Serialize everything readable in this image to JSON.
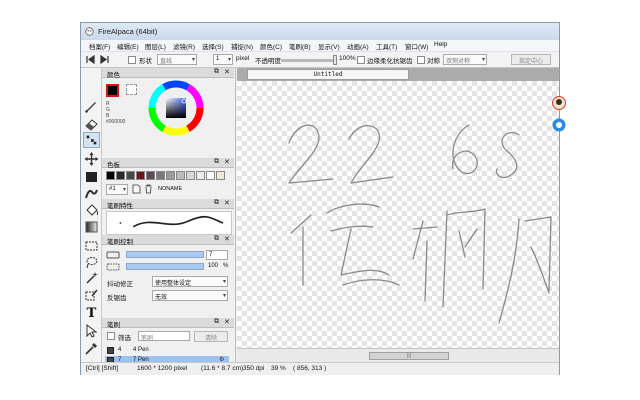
{
  "window": {
    "title": "FireAlpaca (64bit)"
  },
  "menu": [
    "档案(F)",
    "编辑(E)",
    "图层(L)",
    "滤镜(R)",
    "选择(S)",
    "捕捉(N)",
    "颜色(C)",
    "笔刷(B)",
    "显示(V)",
    "动画(A)",
    "工具(T)",
    "窗口(W)",
    "Help"
  ],
  "toolbar": {
    "shape_label": "形状",
    "shape_value": "直线",
    "size_value": "1",
    "size_unit": "pixel",
    "opacity_label": "不透明度",
    "opacity_value": "100%",
    "opacity_fraction": 1.0,
    "antialias_label": "边缘柔化抗锯齿",
    "symmetry_label": "对称",
    "symmetry_value": "双侧对称",
    "center_button": "指定中心"
  },
  "panels": {
    "color": {
      "title": "颜色",
      "channel_labels": [
        "R",
        "G",
        "B"
      ],
      "hex": "#000000",
      "fg_color": "#000000",
      "bg_color": "#ffffff"
    },
    "palette": {
      "title": "色板",
      "selector": "#1",
      "name": "NONAME",
      "swatches": [
        "#000000",
        "#2a2a2a",
        "#4a4a4a",
        "#6a1616",
        "#5a4a5a",
        "#7a7a7a",
        "#9b9b9b",
        "#bcbcbc",
        "#d8d8d8",
        "#ececec",
        "#ffffff",
        "#f0e8dc"
      ]
    },
    "brush_stroke": {
      "title": "笔刷特性"
    },
    "brush_control": {
      "title": "笔刷控制",
      "size_value": "7",
      "size_fraction": 1.0,
      "opacity_value": "100",
      "opacity_unit": "%",
      "opacity_fraction": 1.0,
      "stabilizer_label": "抖动修正",
      "stabilizer_value": "使用整体设定",
      "antialias_label": "反锯齿",
      "antialias_value": "无效"
    },
    "brush_list": {
      "title": "笔刷",
      "filter_label": "筛选",
      "search_value": "笔刷",
      "clear_button": "清除",
      "items": [
        {
          "num": "4",
          "name": "4  Pen",
          "selected": false
        },
        {
          "num": "7",
          "name": "7  Pen",
          "selected": true
        }
      ]
    }
  },
  "document": {
    "tab_label": "Untitled"
  },
  "status": {
    "keys": "[Ctrl] [Shift]",
    "size": "1600 * 1200 pixel",
    "cm": "(11.6 * 8.7 cm)",
    "dpi": "350 dpi",
    "zoom": "39 %",
    "coords": "( 856, 313 )"
  },
  "colors": {
    "accent": "#9cc3ee",
    "selection": "#d5e2f3"
  }
}
